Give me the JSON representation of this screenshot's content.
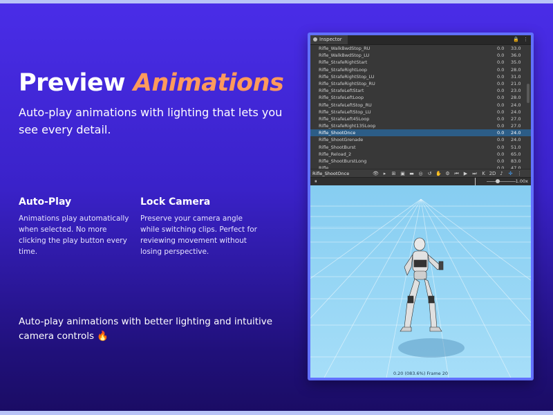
{
  "hero": {
    "title_plain": "Preview",
    "title_accent": "Animations",
    "subtitle": "Auto-play animations with lighting that lets you see every detail."
  },
  "features": [
    {
      "title": "Auto-Play",
      "text": "Animations play automatically when selected. No more clicking the play button every time."
    },
    {
      "title": "Lock Camera",
      "text": "Preserve your camera angle while switching clips. Perfect for reviewing movement without losing perspective."
    }
  ],
  "footer": {
    "text": "Auto-play animations with better lighting and intuitive camera controls",
    "emoji": "🔥"
  },
  "inspector": {
    "tab_label": "Inspector",
    "tab_actions": [
      "🔒",
      "⋮"
    ],
    "clips": [
      {
        "name": "Rifle_WalkBwdStop_RU",
        "v1": "0.0",
        "v2": "33.0"
      },
      {
        "name": "Rifle_WalkBwdStop_LU",
        "v1": "0.0",
        "v2": "36.0"
      },
      {
        "name": "Rifle_StrafeRightStart",
        "v1": "0.0",
        "v2": "35.0"
      },
      {
        "name": "Rifle_StrafeRightLoop",
        "v1": "0.0",
        "v2": "28.0"
      },
      {
        "name": "Rifle_StrafeRightStop_LU",
        "v1": "0.0",
        "v2": "31.0"
      },
      {
        "name": "Rifle_StrafeRightStop_RU",
        "v1": "0.0",
        "v2": "21.0"
      },
      {
        "name": "Rifle_StrafeLeftStart",
        "v1": "0.0",
        "v2": "23.0"
      },
      {
        "name": "Rifle_StrafeLeftLoop",
        "v1": "0.0",
        "v2": "28.0"
      },
      {
        "name": "Rifle_StrafeLeftStop_RU",
        "v1": "0.0",
        "v2": "24.0"
      },
      {
        "name": "Rifle_StrafeLeftStop_LU",
        "v1": "0.0",
        "v2": "24.0"
      },
      {
        "name": "Rifle_StrafeLeft45Loop",
        "v1": "0.0",
        "v2": "27.0"
      },
      {
        "name": "Rifle_StrafeRight135Loop",
        "v1": "0.0",
        "v2": "27.0"
      },
      {
        "name": "Rifle_ShootOnce",
        "v1": "0.0",
        "v2": "24.0"
      },
      {
        "name": "Rifle_ShootGrenade",
        "v1": "0.0",
        "v2": "24.0"
      },
      {
        "name": "Rifle_ShootBurst",
        "v1": "0.0",
        "v2": "51.0"
      },
      {
        "name": "Rifle_Reload_2",
        "v1": "0.0",
        "v2": "65.0"
      },
      {
        "name": "Rifle_ShootBurstLong",
        "v1": "0.0",
        "v2": "83.0"
      },
      {
        "name": "Rifle_...",
        "v1": "0.0",
        "v2": "47.0"
      }
    ],
    "selected_clip": "Rifle_ShootOnce",
    "toolbar": {
      "clip_name": "Rifle_ShootOnce",
      "tools": [
        {
          "name": "visibility-icon",
          "glyph": "👁"
        },
        {
          "name": "play-icon",
          "glyph": "▸"
        },
        {
          "name": "grid-icon",
          "glyph": "⊞"
        },
        {
          "name": "image-icon",
          "glyph": "▣"
        },
        {
          "name": "camera-icon",
          "glyph": "▬"
        },
        {
          "name": "lock-icon",
          "glyph": "◎"
        },
        {
          "name": "loop-icon",
          "glyph": "↺"
        },
        {
          "name": "hand-icon",
          "glyph": "✋"
        },
        {
          "name": "gear-icon",
          "glyph": "⚙"
        },
        {
          "name": "step-back-icon",
          "glyph": "⏮"
        },
        {
          "name": "play-button-icon",
          "glyph": "▶"
        },
        {
          "name": "step-forward-icon",
          "glyph": "⏭"
        },
        {
          "name": "timeline-icon",
          "glyph": "K"
        },
        {
          "name": "2d-toggle",
          "glyph": "2D"
        },
        {
          "name": "audio-icon",
          "glyph": "♪"
        },
        {
          "name": "gizmo-icon",
          "glyph": "✣",
          "blue": true
        },
        {
          "name": "more-icon",
          "glyph": "⋮"
        }
      ]
    },
    "playback": {
      "pause_glyph": "⏸",
      "speed": "1.00x"
    },
    "viewport": {
      "frame_label": "0.20 (083.6%) Frame 20"
    }
  },
  "colors": {
    "accent": "#ff9a5c",
    "panel_border": "#6170ff",
    "selected_row": "#2c5d87"
  }
}
